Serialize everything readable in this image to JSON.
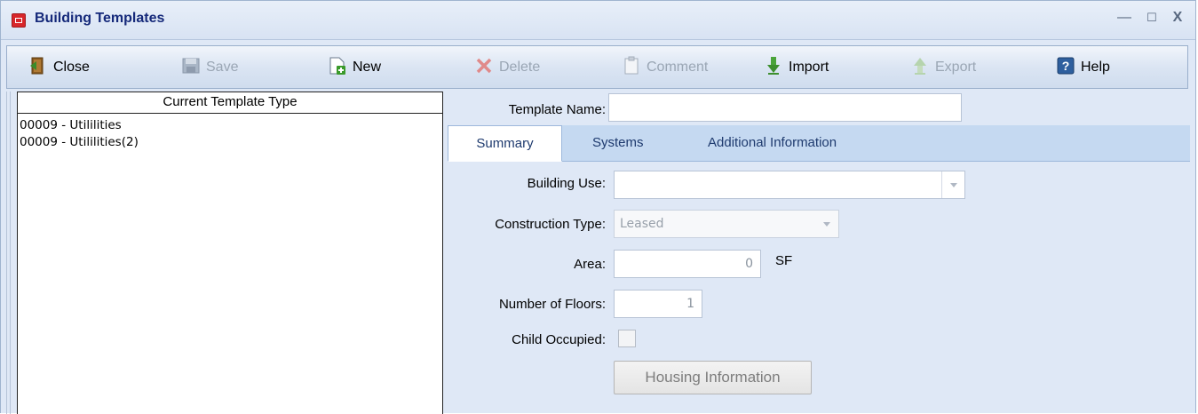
{
  "window": {
    "title": "Building Templates",
    "minimize_glyph": "—",
    "maximize_glyph": "☐",
    "close_glyph": "X"
  },
  "toolbar": {
    "close": "Close",
    "save": "Save",
    "new": "New",
    "delete": "Delete",
    "comment": "Comment",
    "import": "Import",
    "export": "Export",
    "help": "Help"
  },
  "left_panel": {
    "header": "Current Template Type",
    "items": [
      "00009 - Utililities",
      "00009 - Utililities(2)"
    ]
  },
  "form": {
    "template_name_label": "Template Name:",
    "template_name_value": "",
    "tabs": [
      "Summary",
      "Systems",
      "Additional Information"
    ],
    "active_tab": "Summary",
    "building_use_label": "Building Use:",
    "building_use_value": "",
    "construction_type_label": "Construction Type:",
    "construction_type_value": "Leased",
    "area_label": "Area:",
    "area_value": "0",
    "area_unit": "SF",
    "floors_label": "Number of Floors:",
    "floors_value": "1",
    "child_occupied_label": "Child Occupied:",
    "child_occupied_checked": false,
    "housing_button": "Housing Information"
  }
}
